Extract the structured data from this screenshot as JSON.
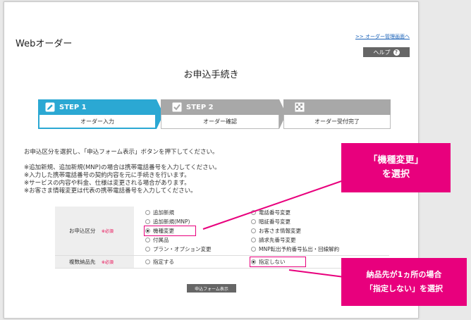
{
  "header": {
    "brand": "Webオーダー",
    "admin_link": ">> オーダー管理画面へ",
    "help_label": "ヘルプ"
  },
  "page_title": "お申込手続き",
  "steps": [
    {
      "label": "STEP 1",
      "sub": "オーダー入力",
      "active": true
    },
    {
      "label": "STEP 2",
      "sub": "オーダー確認",
      "active": false
    },
    {
      "label": "",
      "sub": "オーダー受付完了",
      "active": false
    }
  ],
  "instruction": "お申込区分を選択し、「申込フォーム表示」ボタンを押下してください。",
  "notes": [
    "※追加新規、追加新規(MNP)の場合は携帯電話番号を入力してください。",
    "※入力した携帯電話番号の契約内容を元に手続きを行います。",
    "※サービスの内容や料金、仕様は変更される場合があります。",
    "※お客さま情報変更は代表の携帯電話番号を入力してください。"
  ],
  "form": {
    "required_mark": "※必須",
    "category_label": "お申込区分",
    "options_left": [
      "追加新規",
      "追加新規(MNP)",
      "機種変更",
      "付属品",
      "プラン・オプション変更"
    ],
    "options_right": [
      "電話番号変更",
      "暗証番号変更",
      "お客さま情報変更",
      "請求先番号変更",
      "MNP転出予約番号払出・回線解約"
    ],
    "selected_option": "機種変更",
    "delivery_label": "複数納品先",
    "delivery_options": [
      "指定する",
      "指定しない"
    ],
    "delivery_selected": "指定しない"
  },
  "submit_label": "申込フォーム表示",
  "callouts": {
    "one_line1": "「機種変更」",
    "one_line2": "を選択",
    "two_line1": "納品先が1ヵ所の場合",
    "two_line2": "「指定しない」を選択"
  },
  "colors": {
    "accent": "#e8007d",
    "step_active": "#2ba8d3",
    "step_inactive": "#a8a8a8"
  }
}
